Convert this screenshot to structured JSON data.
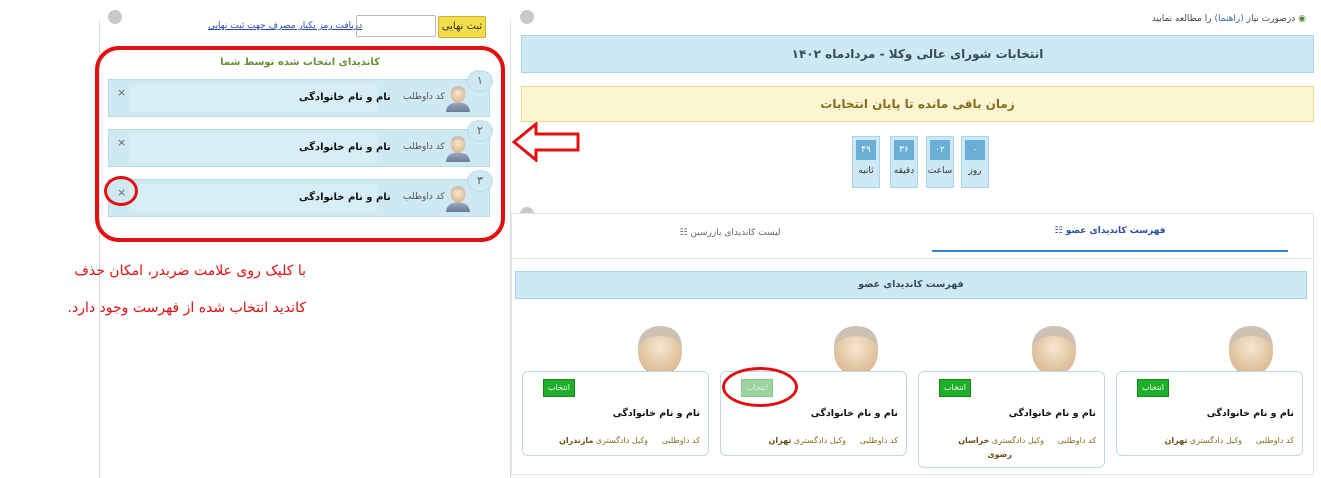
{
  "left_panel": {
    "submit_label": "ثبت نهایی",
    "password_value": "",
    "password_placeholder": "",
    "getpass_link": "دریافت رمز یکبار مصرف جهت ثبت نهایی",
    "selected_title": "کاندیدای انتخاب شده توسط شما",
    "selected": [
      {
        "num": "۱",
        "code_label": "کد داوطلب",
        "name": "نام و نام خانوادگی",
        "close": "×"
      },
      {
        "num": "۲",
        "code_label": "کد داوطلب",
        "name": "نام و نام خانوادگی",
        "close": "×"
      },
      {
        "num": "۳",
        "code_label": "کد داوطلب",
        "name": "نام و نام خانوادگی",
        "close": "×"
      }
    ],
    "note_line1": "با کلیک روی علامت ضربدر، امکان حذف",
    "note_line2": "کاندید انتخاب شده از فهرست وجود دارد."
  },
  "right_panel": {
    "guide_prefix": "درصورت نیاز",
    "guide_link": "(راهنما)",
    "guide_suffix": "را مطالعه نمایید",
    "title": "انتخابات شورای عالی وکلا - مردادماه ۱۴۰۲",
    "remaining_title": "زمان باقی مانده تا پایان انتخابات",
    "timer": {
      "days": {
        "value": "۰",
        "label": "روز"
      },
      "hours": {
        "value": "۰۲",
        "label": "ساعت"
      },
      "minutes": {
        "value": "۳۶",
        "label": "دقیقه"
      },
      "seconds": {
        "value": "۴۹",
        "label": "ثانیه"
      }
    },
    "tabs": {
      "members": "فهرست کاندیدای عضو",
      "inspectors": "لیست کاندیدای بازرسین"
    },
    "list_header": "فهرست کاندیدای عضو",
    "cards": [
      {
        "choose": "انتخاب",
        "name": "نام و نام خانوادگی",
        "code_label": "کد داوطلبی",
        "bar_prefix": "وکیل دادگستری",
        "bar_city": "تهران",
        "bar_extra": ""
      },
      {
        "choose": "انتخاب",
        "name": "نام و نام خانوادگی",
        "code_label": "کد داوطلبی",
        "bar_prefix": "وکیل دادگستری",
        "bar_city": "خراسان",
        "bar_extra": "رضوی"
      },
      {
        "choose": "انتخاب",
        "name": "نام و نام خانوادگی",
        "code_label": "کد داوطلبی",
        "bar_prefix": "وکیل دادگستری",
        "bar_city": "تهران",
        "bar_extra": ""
      },
      {
        "choose": "انتخاب",
        "name": "نام و نام خانوادگی",
        "code_label": "کد داوطلبی",
        "bar_prefix": "وکیل دادگستری",
        "bar_city": "مازندران",
        "bar_extra": ""
      }
    ]
  },
  "colors": {
    "accent_red": "#e01010",
    "info_blue": "#cde9f5",
    "warning_yellow": "#fcf5d1",
    "choose_green": "#1fae2a",
    "submit_yellow": "#f2dd4b"
  }
}
